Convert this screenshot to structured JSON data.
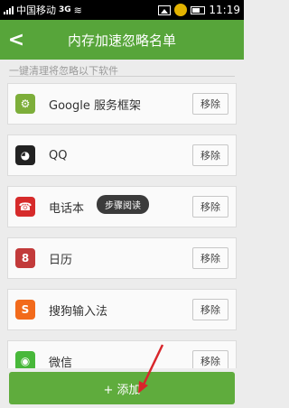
{
  "status_bar": {
    "carrier": "中国移动",
    "network": "3G",
    "time": "11:19"
  },
  "header": {
    "back_icon": "chevron-left-icon",
    "title": "内存加速忽略名单"
  },
  "hint": "一键清理将忽略以下软件",
  "apps": [
    {
      "name": "Google 服务框架",
      "icon": "android-icon",
      "color": "#7dae3a",
      "glyph": "⚙",
      "remove": "移除"
    },
    {
      "name": "QQ",
      "icon": "qq-penguin-icon",
      "color": "#222222",
      "glyph": "◕",
      "remove": "移除"
    },
    {
      "name": "电话本",
      "icon": "contacts-icon",
      "color": "#d62b2b",
      "glyph": "☎",
      "remove": "移除"
    },
    {
      "name": "日历",
      "icon": "calendar-icon",
      "color": "#c23a3a",
      "glyph": "8",
      "remove": "移除"
    },
    {
      "name": "搜狗输入法",
      "icon": "sogou-icon",
      "color": "#f26a1b",
      "glyph": "S",
      "remove": "移除"
    },
    {
      "name": "微信",
      "icon": "wechat-icon",
      "color": "#48b83a",
      "glyph": "◉",
      "remove": "移除"
    }
  ],
  "tooltip": "步骤阅读",
  "add_button": "+ 添加"
}
